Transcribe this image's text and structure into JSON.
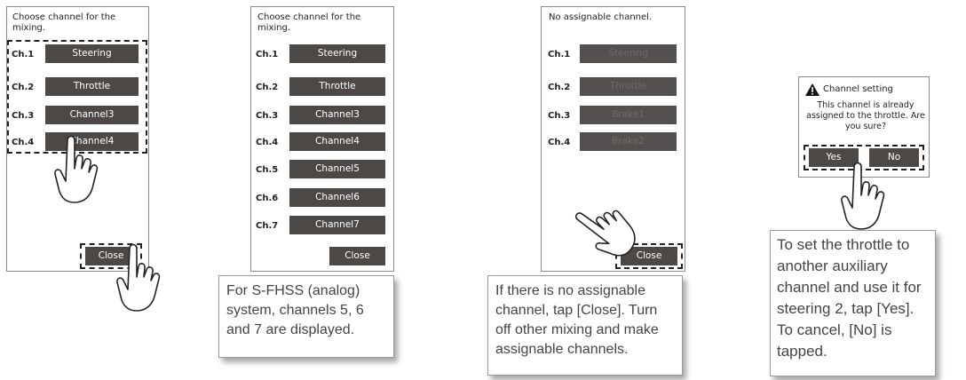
{
  "screen1": {
    "title": "Choose channel for the mixing.",
    "rows": [
      {
        "label": "Ch.1",
        "value": "Steering"
      },
      {
        "label": "Ch.2",
        "value": "Throttle"
      },
      {
        "label": "Ch.3",
        "value": "Channel3"
      },
      {
        "label": "Ch.4",
        "value": "Channel4"
      }
    ],
    "close_label": "Close"
  },
  "screen2": {
    "title": "Choose channel for the mixing.",
    "rows": [
      {
        "label": "Ch.1",
        "value": "Steering"
      },
      {
        "label": "Ch.2",
        "value": "Throttle"
      },
      {
        "label": "Ch.3",
        "value": "Channel3"
      },
      {
        "label": "Ch.4",
        "value": "Channel4"
      },
      {
        "label": "Ch.5",
        "value": "Channel5"
      },
      {
        "label": "Ch.6",
        "value": "Channel6"
      },
      {
        "label": "Ch.7",
        "value": "Channel7"
      }
    ],
    "close_label": "Close",
    "note": "For S-FHSS (analog) system, channels 5, 6 and 7 are displayed."
  },
  "screen3": {
    "title": "No assignable channel.",
    "rows": [
      {
        "label": "Ch.1",
        "value": "Steering"
      },
      {
        "label": "Ch.2",
        "value": "Throttle"
      },
      {
        "label": "Ch.3",
        "value": "Brake1"
      },
      {
        "label": "Ch.4",
        "value": "Brake2"
      }
    ],
    "close_label": "Close",
    "note": "If there is no assignable channel, tap [Close]. Turn off other mixing and make assignable channels."
  },
  "dialog": {
    "title": "Channel setting",
    "message": "This channel is already assigned to the throttle. Are you sure?",
    "yes_label": "Yes",
    "no_label": "No",
    "warning_icon": "warning-triangle-icon",
    "note": "To set the throttle to another auxiliary channel and use it for steering 2, tap [Yes]. To cancel, [No] is tapped."
  },
  "colors": {
    "button_bg": "#4c4846",
    "button_text": "#ffffff",
    "disabled_text": "#6e6a68",
    "note_text": "#444444"
  }
}
